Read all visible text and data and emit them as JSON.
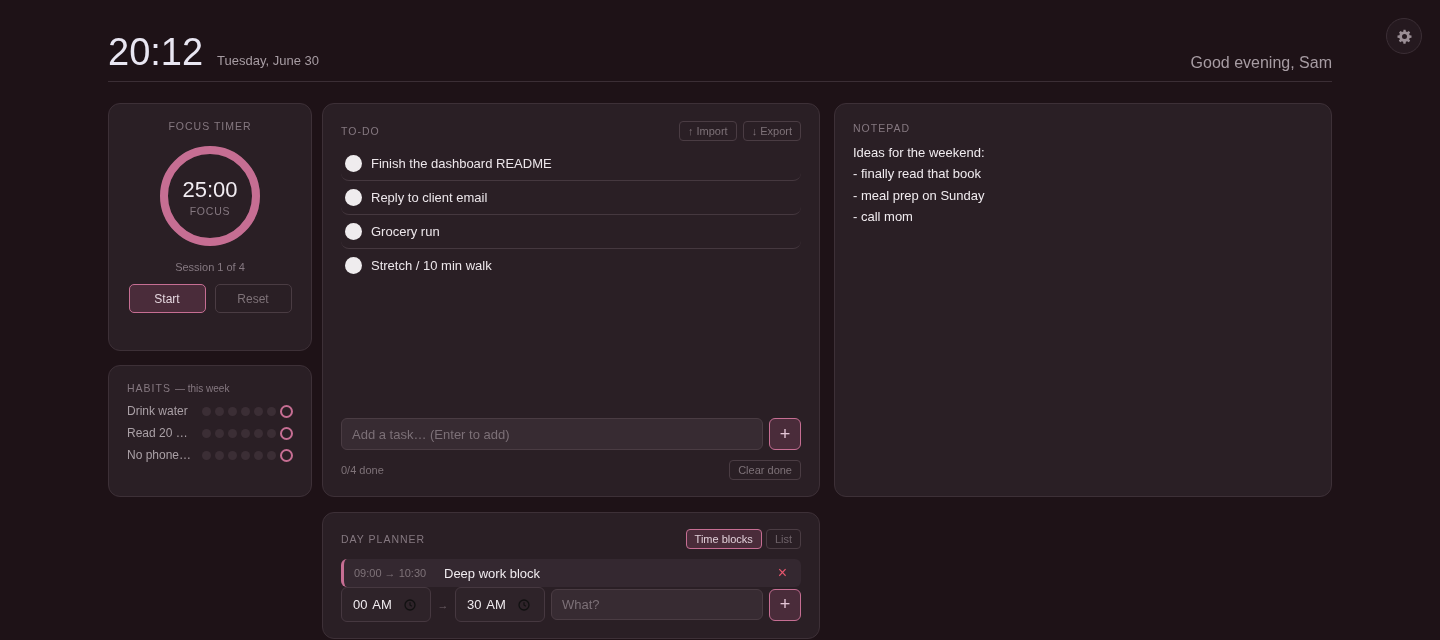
{
  "header": {
    "time": "20:12",
    "date": "Tuesday, June 30",
    "greeting": "Good evening, Sam"
  },
  "focus_timer": {
    "title": "FOCUS TIMER",
    "time": "25:00",
    "mode": "FOCUS",
    "level": 1,
    "session": "Session 1 of 4",
    "buttons": [
      {
        "label": "Start",
        "kind": "primary"
      },
      {
        "label": "Reset",
        "kind": "secondary"
      }
    ]
  },
  "habits": {
    "title": "HABITS",
    "subtitle": "— this week",
    "items": [
      {
        "name": "Drink water",
        "days": [
          {
            "done": false,
            "today": false
          },
          {
            "done": false,
            "today": false
          },
          {
            "done": false,
            "today": false
          },
          {
            "done": false,
            "today": false
          },
          {
            "done": false,
            "today": false
          },
          {
            "done": false,
            "today": false
          },
          {
            "done": false,
            "today": true
          }
        ]
      },
      {
        "name": "Read 20 …",
        "days": [
          {
            "done": false,
            "today": false
          },
          {
            "done": false,
            "today": false
          },
          {
            "done": false,
            "today": false
          },
          {
            "done": false,
            "today": false
          },
          {
            "done": false,
            "today": false
          },
          {
            "done": false,
            "today": false
          },
          {
            "done": false,
            "today": true
          }
        ]
      },
      {
        "name": "No phone…",
        "days": [
          {
            "done": false,
            "today": false
          },
          {
            "done": false,
            "today": false
          },
          {
            "done": false,
            "today": false
          },
          {
            "done": false,
            "today": false
          },
          {
            "done": false,
            "today": false
          },
          {
            "done": false,
            "today": false
          },
          {
            "done": false,
            "today": true
          }
        ]
      }
    ]
  },
  "todo": {
    "title": "TO-DO",
    "actions": [
      "↑ Import",
      "↓ Export"
    ],
    "items": [
      {
        "text": "Finish the dashboard README",
        "done": false
      },
      {
        "text": "Reply to client email",
        "done": false
      },
      {
        "text": "Grocery run",
        "done": false
      },
      {
        "text": "Stretch / 10 min walk",
        "done": false
      }
    ],
    "input": {
      "placeholder": "Add a task… (Enter to add)"
    },
    "add_button": "+",
    "summary": "0/4 done",
    "clear_button": "Clear done"
  },
  "notepad": {
    "title": "NOTEPAD",
    "lines": [
      "Ideas for the weekend:",
      "- finally read that book",
      "- meal prep on Sunday",
      "- call mom"
    ]
  },
  "planner": {
    "title": "DAY PLANNER",
    "tabs": [
      {
        "label": "Time blocks",
        "selected": true
      },
      {
        "label": "List",
        "selected": false
      }
    ],
    "blocks": [
      {
        "time": "09:00 → 10:30",
        "title": "Deep work block",
        "remove": "×"
      }
    ],
    "form": {
      "start": "00 AM",
      "separator": "→",
      "end": "30 AM",
      "what": {
        "placeholder": "What?"
      },
      "add_button": "+"
    }
  }
}
